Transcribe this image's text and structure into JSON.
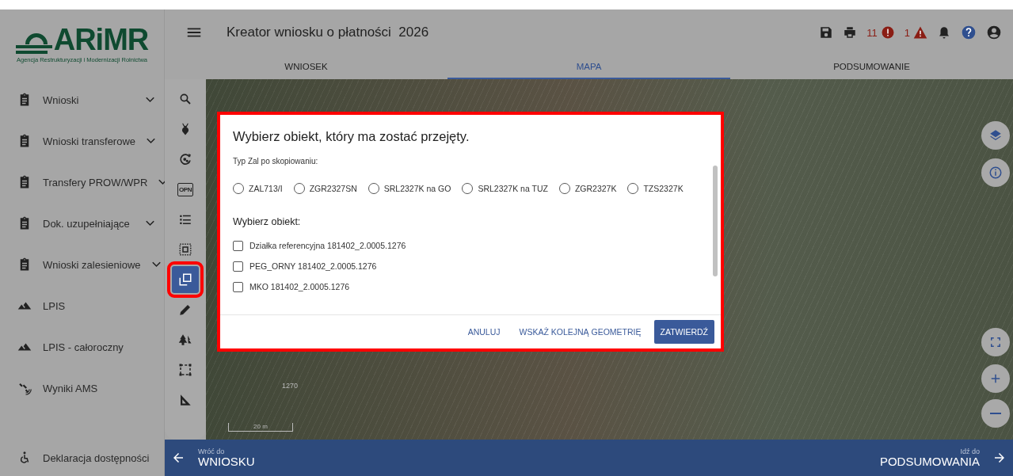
{
  "logo": {
    "name": "ARiMR",
    "subtitle": "Agencja Restrukturyzacji i Modernizacji Rolnictwa"
  },
  "sidebar": {
    "items": [
      {
        "kind": "clipboard",
        "label": "Wnioski",
        "expandable": true
      },
      {
        "kind": "clipboard",
        "label": "Wnioski transferowe",
        "expandable": true
      },
      {
        "kind": "clipboard",
        "label": "Transfery PROW/WPR",
        "expandable": true
      },
      {
        "kind": "clipboard",
        "label": "Dok. uzupełniające",
        "expandable": true
      },
      {
        "kind": "clipboard",
        "label": "Wnioski zalesieniowe",
        "expandable": true
      },
      {
        "kind": "terrain",
        "label": "LPIS",
        "expandable": false
      },
      {
        "kind": "terrain",
        "label": "LPIS - całoroczny",
        "expandable": false
      },
      {
        "kind": "satellite",
        "label": "Wyniki AMS",
        "expandable": false
      }
    ],
    "footer_item": {
      "kind": "accessibility",
      "label": "Deklaracja dostępności"
    }
  },
  "header": {
    "title": "Kreator wniosku o płatności  2026",
    "error_count": "11",
    "warning_count": "1"
  },
  "tabs": [
    {
      "label": "WNIOSEK",
      "selected": false
    },
    {
      "label": "MAPA",
      "selected": true
    },
    {
      "label": "PODSUMOWANIE",
      "selected": false
    }
  ],
  "tools": [
    {
      "kind": "search",
      "selected": false,
      "highlighted": false
    },
    {
      "kind": "beet",
      "selected": false,
      "highlighted": false
    },
    {
      "kind": "refresh-plant",
      "selected": false,
      "highlighted": false
    },
    {
      "kind": "badge",
      "label": "OPN",
      "selected": false,
      "highlighted": false
    },
    {
      "kind": "list",
      "selected": false,
      "highlighted": false
    },
    {
      "kind": "select-area",
      "selected": false,
      "highlighted": false
    },
    {
      "kind": "copy",
      "selected": true,
      "highlighted": true
    },
    {
      "kind": "pencil",
      "selected": false,
      "highlighted": false
    },
    {
      "kind": "trees",
      "selected": false,
      "highlighted": false
    },
    {
      "kind": "dashed-rect",
      "selected": false,
      "highlighted": false
    },
    {
      "kind": "set-square",
      "selected": false,
      "highlighted": false
    }
  ],
  "map": {
    "parcel_label": "1270",
    "scale": "20 m"
  },
  "map_controls": [
    {
      "kind": "layers"
    },
    {
      "kind": "info"
    },
    {
      "kind": "fullscreen"
    },
    {
      "kind": "zoom-in"
    },
    {
      "kind": "zoom-out"
    }
  ],
  "dialog": {
    "highlighted": true,
    "title": "Wybierz obiekt, który ma zostać przejęty.",
    "type_label": "Typ Zal po skopiowaniu:",
    "type_options": [
      {
        "label": "ZAL713/I",
        "selected": false
      },
      {
        "label": "ZGR2327SN",
        "selected": false
      },
      {
        "label": "SRL2327K na GO",
        "selected": false
      },
      {
        "label": "SRL2327K na TUZ",
        "selected": false
      },
      {
        "label": "ZGR2327K",
        "selected": false
      },
      {
        "label": "TZS2327K",
        "selected": false
      }
    ],
    "object_label": "Wybierz obiekt:",
    "objects": [
      {
        "label": "Działka referencyjna 181402_2.0005.1276",
        "checked": false
      },
      {
        "label": "PEG_ORNY 181402_2.0005.1276",
        "checked": false
      },
      {
        "label": "MKO 181402_2.0005.1276",
        "checked": false
      }
    ],
    "buttons": [
      {
        "kind": "text",
        "label": "ANULUJ"
      },
      {
        "kind": "text",
        "label": "WSKAŻ KOLEJNĄ GEOMETRIĘ"
      },
      {
        "kind": "primary",
        "label": "ZATWIERDŹ"
      }
    ]
  },
  "bottom_bar": {
    "back_caption": "Wróć do",
    "back_label": "WNIOSKU",
    "next_caption": "Idź do",
    "next_label": "PODSUMOWANIA"
  }
}
